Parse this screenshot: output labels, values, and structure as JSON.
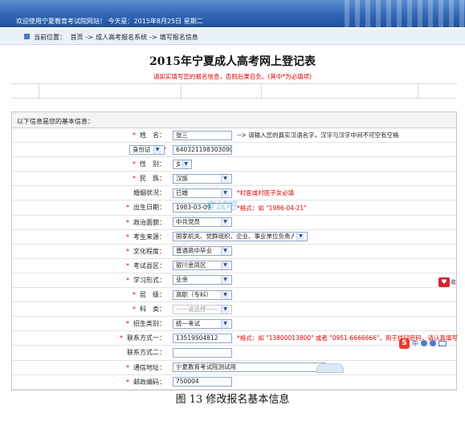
{
  "header": {
    "welcome": "欢迎使用宁夏教育考试院网站！ 今天是：2015年8月25日 星期二"
  },
  "breadcrumb": {
    "prefix": "当前位置：",
    "items": [
      "首页",
      "->",
      "成人高考报名系统",
      "->",
      "填写报名信息"
    ]
  },
  "page": {
    "title": "2015年宁夏成人高考网上登记表",
    "notice": "请如实填写您的报名信息，否则后果自负。(其中*为必填项)"
  },
  "form": {
    "section_label": "以下信息是您的基本信息：",
    "rows": [
      {
        "label": "姓　名：",
        "required": true,
        "type": "input",
        "value": "张三",
        "width": 74,
        "hint": "--> 请输入您的真实汉语名字，汉字与汉字中间不可空有空格",
        "hint_red": false
      },
      {
        "label": "身份证",
        "required": true,
        "type": "idtype",
        "value": "640321198303090028",
        "width": 74,
        "hint": "",
        "hint_red": false
      },
      {
        "label": "性　别：",
        "required": true,
        "type": "select",
        "value": "女",
        "width": 24,
        "hint": "",
        "hint_red": false
      },
      {
        "label": "民　族：",
        "required": true,
        "type": "select",
        "value": "汉族",
        "width": 74,
        "hint": "",
        "hint_red": false
      },
      {
        "label": "婚姻状况：",
        "required": false,
        "type": "select",
        "value": "已婚",
        "width": 74,
        "hint": "*村医或村医子女必填",
        "hint_red": true
      },
      {
        "label": "出生日期：",
        "required": true,
        "type": "input",
        "value": "1983-03-09",
        "width": 74,
        "hint": "*格式：如 \"1986-04-21\"",
        "hint_red": true
      },
      {
        "label": "政治面貌：",
        "required": true,
        "type": "select",
        "value": "中共党员",
        "width": 74,
        "hint": "",
        "hint_red": false
      },
      {
        "label": "考生来源：",
        "required": true,
        "type": "select",
        "value": "国家机关、党群组织、企业、事业单位负责人",
        "width": 168,
        "hint": "",
        "hint_red": false
      },
      {
        "label": "文化程度：",
        "required": true,
        "type": "select",
        "value": "普通高中毕业",
        "width": 74,
        "hint": "",
        "hint_red": false
      },
      {
        "label": "考试县区：",
        "required": true,
        "type": "select",
        "value": "银川金凤区",
        "width": 74,
        "hint": "",
        "hint_red": false
      },
      {
        "label": "学习形式：",
        "required": true,
        "type": "select",
        "value": "业余",
        "width": 74,
        "hint": "",
        "hint_red": false
      },
      {
        "label": "层　级：",
        "required": true,
        "type": "select",
        "value": "高职（专科）",
        "width": 74,
        "hint": "",
        "hint_red": false
      },
      {
        "label": "科　类：",
        "required": true,
        "type": "select_disabled",
        "value": "——请选择——",
        "width": 74,
        "hint": "",
        "hint_red": false
      },
      {
        "label": "招生类别：",
        "required": true,
        "type": "select",
        "value": "统一考试",
        "width": 74,
        "hint": "",
        "hint_red": false
      },
      {
        "label": "联系方式一：",
        "required": true,
        "type": "input",
        "value": "13519504812",
        "width": 74,
        "hint": "*格式：如 \"13800013800\" 或者 \"0951-6666666\"，用于找回密码，请认真填写",
        "hint_red": true
      },
      {
        "label": "联系方式二：",
        "required": false,
        "type": "input",
        "value": "",
        "width": 74,
        "hint": "",
        "hint_red": false
      },
      {
        "label": "通信地址：",
        "required": true,
        "type": "input",
        "value": "宁夏教育考试院测试用",
        "width": 190,
        "hint": "",
        "hint_red": false
      },
      {
        "label": "邮政编码：",
        "required": true,
        "type": "input",
        "value": "750004",
        "width": 74,
        "hint": "",
        "hint_red": false
      }
    ]
  },
  "floating": {
    "heart_label": "收",
    "ime_label": "中"
  },
  "watermark": "考试吧",
  "caption": "图 13  修改报名基本信息",
  "colors": {
    "banner": "#2f65b6",
    "required": "#e00000",
    "notice": "#d40000"
  }
}
